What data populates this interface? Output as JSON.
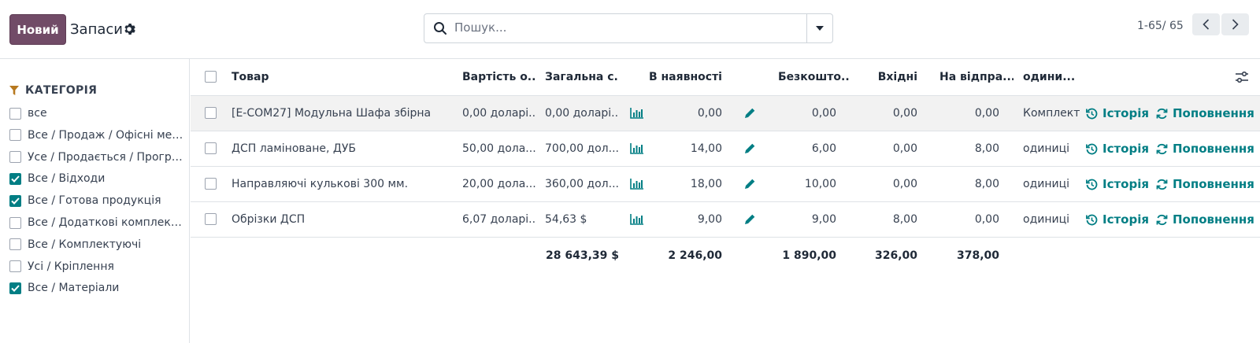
{
  "control_panel": {
    "new_button": "Новий",
    "title": "Запаси",
    "search_placeholder": "Пошук...",
    "pager": "1-65/ 65"
  },
  "sidebar": {
    "heading": "КАТЕГОРІЯ",
    "categories": [
      {
        "label": "все",
        "checked": false
      },
      {
        "label": "Все / Продаж / Офісні меблі",
        "checked": false
      },
      {
        "label": "Усе / Продається / Програмне забезпечення",
        "checked": false
      },
      {
        "label": "Все / Відходи",
        "checked": true
      },
      {
        "label": "Все / Готова продукція",
        "checked": true
      },
      {
        "label": "Все / Додаткові комплектуючі",
        "checked": false
      },
      {
        "label": "Все / Комплектуючі",
        "checked": false
      },
      {
        "label": "Усі / Кріплення",
        "checked": false
      },
      {
        "label": "Все / Матеріали",
        "checked": true
      }
    ]
  },
  "table": {
    "headers": {
      "product": "Товар",
      "unit_value": "Вартість о...",
      "total_value": "Загальна с...",
      "on_hand": "В наявності",
      "free": "Безкошто...",
      "incoming": "Вхідні",
      "outgoing": "На відпра...",
      "uom": "одини..."
    },
    "rows": [
      {
        "product": "[E-COM27] Модульна Шафа збірна",
        "unit_value": "0,00 доларі...",
        "total_value": "0,00 доларі...",
        "on_hand": "0,00",
        "free": "0,00",
        "incoming": "0,00",
        "outgoing": "0,00",
        "uom": "Комплект",
        "history": "Історія",
        "replenish": "Поповнення"
      },
      {
        "product": "ДСП ламіноване, ДУБ",
        "unit_value": "50,00 дола...",
        "total_value": "700,00 дол...",
        "on_hand": "14,00",
        "free": "6,00",
        "incoming": "0,00",
        "outgoing": "8,00",
        "uom": "одиниці",
        "history": "Історія",
        "replenish": "Поповнення"
      },
      {
        "product": "Направляючі кулькові 300 мм.",
        "unit_value": "20,00 дола...",
        "total_value": "360,00 дол...",
        "on_hand": "18,00",
        "free": "10,00",
        "incoming": "0,00",
        "outgoing": "8,00",
        "uom": "одиниці",
        "history": "Історія",
        "replenish": "Поповнення"
      },
      {
        "product": "Обрізки ДСП",
        "unit_value": "6,07 доларі...",
        "total_value": "54,63 $",
        "on_hand": "9,00",
        "free": "9,00",
        "incoming": "8,00",
        "outgoing": "0,00",
        "uom": "одиниці",
        "history": "Історія",
        "replenish": "Поповнення"
      }
    ],
    "totals": {
      "total_value": "28 643,39 $",
      "on_hand": "2 246,00",
      "free": "1 890,00",
      "incoming": "326,00",
      "outgoing": "378,00"
    }
  },
  "colors": {
    "primary": "#714b67",
    "accent": "#017e84"
  }
}
